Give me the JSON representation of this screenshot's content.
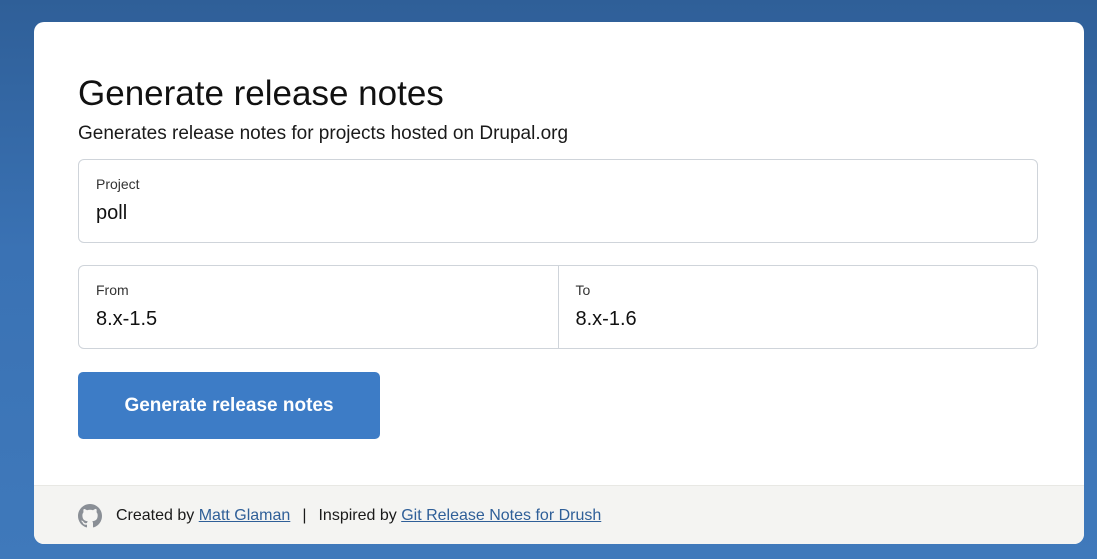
{
  "header": {
    "title": "Generate release notes",
    "subtitle": "Generates release notes for projects hosted on Drupal.org"
  },
  "form": {
    "project": {
      "label": "Project",
      "value": "poll"
    },
    "from": {
      "label": "From",
      "value": "8.x-1.5"
    },
    "to": {
      "label": "To",
      "value": "8.x-1.6"
    },
    "submit_label": "Generate release notes"
  },
  "footer": {
    "icon": "github-icon",
    "created_by_text": "Created by",
    "author_link": "Matt Glaman",
    "separator": "|",
    "inspired_by_text": "Inspired by",
    "inspiration_link": "Git Release Notes for Drush"
  },
  "colors": {
    "background": "#3a72b4",
    "button": "#3d7cc6",
    "link": "#2f5f98",
    "footer_bg": "#f4f4f2"
  }
}
